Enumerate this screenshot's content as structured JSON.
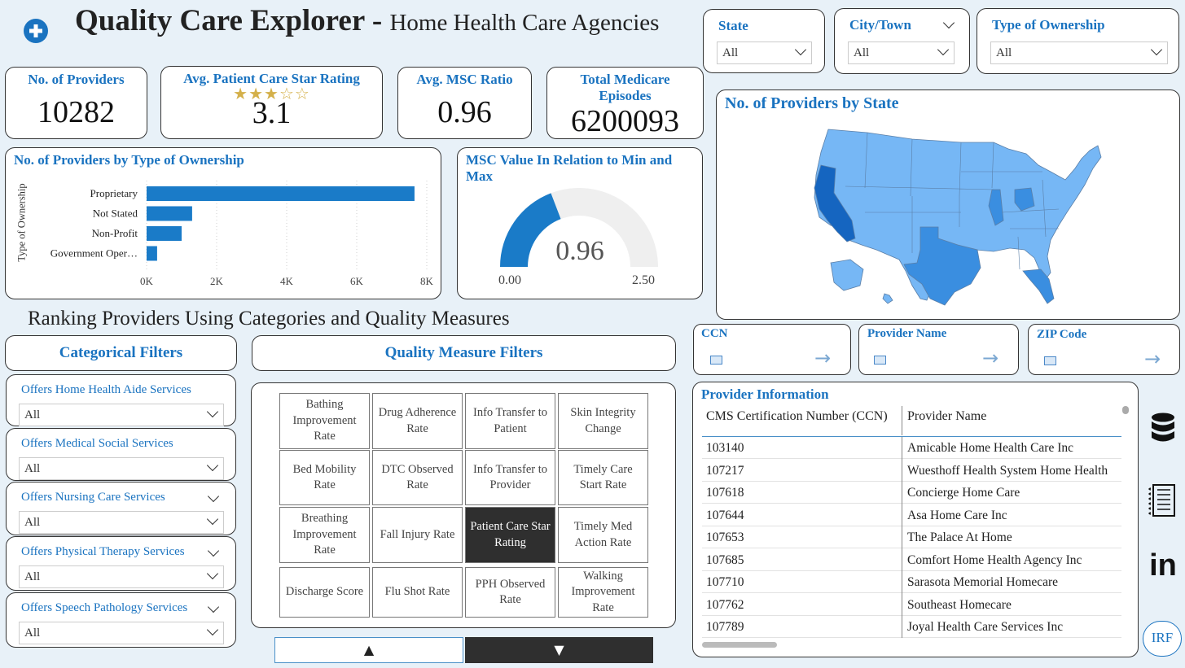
{
  "header": {
    "title_bold": "Quality Care Explorer",
    "title_dash": " - ",
    "title_sub": "Home Health Care Agencies",
    "add_icon": "plus-circle-icon"
  },
  "kpis": {
    "providers": {
      "label": "No. of Providers",
      "value": "10282"
    },
    "star": {
      "label": "Avg. Patient Care Star Rating",
      "stars": "★★★☆☆",
      "rating": 3.1,
      "value": "3.1"
    },
    "msc": {
      "label": "Avg. MSC Ratio",
      "value": "0.96"
    },
    "episodes": {
      "label": "Total Medicare Episodes",
      "value": "6200093"
    }
  },
  "slicers": {
    "state": {
      "label": "State",
      "value": "All"
    },
    "city": {
      "label": "City/Town",
      "value": "All"
    },
    "ownership": {
      "label": "Type of Ownership",
      "value": "All"
    }
  },
  "ownership_chart": {
    "title": "No. of Providers by Type of Ownership",
    "ylabel": "Type of Ownership",
    "ticks": [
      "0K",
      "2K",
      "4K",
      "6K",
      "8K"
    ]
  },
  "gauge": {
    "title_line1": "MSC Value In Relation to Min and",
    "title_line2": "Max",
    "value_label": "0.96",
    "min_label": "0.00",
    "max_label": "2.50",
    "value": 0.96,
    "min": 0,
    "max": 2.5,
    "fill_color": "#1a7bc8",
    "track_color": "#efefef"
  },
  "map": {
    "title": "No. of Providers by State",
    "colors": {
      "base": "#76b7f5",
      "mid": "#3a8ee0",
      "high": "#1565c0",
      "border": "#5a7fa8"
    }
  },
  "ranking": {
    "heading": "Ranking Providers Using Categories and Quality Measures",
    "categorical_title": "Categorical Filters",
    "quality_title": "Quality Measure Filters",
    "categorical": [
      {
        "label": "Offers Home Health Aide Services",
        "value": "All"
      },
      {
        "label": "Offers Medical Social Services",
        "value": "All"
      },
      {
        "label": "Offers Nursing Care Services",
        "value": "All"
      },
      {
        "label": "Offers Physical Therapy Services",
        "value": "All"
      },
      {
        "label": "Offers Speech Pathology Services",
        "value": "All"
      }
    ],
    "quality_grid": [
      [
        "Bathing Improvement Rate",
        "Drug Adherence Rate",
        "Info Transfer to Patient",
        "Skin Integrity Change"
      ],
      [
        "Bed Mobility Rate",
        "DTC Observed Rate",
        "Info Transfer to Provider",
        "Timely Care Start Rate"
      ],
      [
        "Breathing Improvement Rate",
        "Fall Injury Rate",
        "Patient Care Star Rating",
        "Timely Med Action Rate"
      ],
      [
        "Discharge Score",
        "Flu Shot Rate",
        "PPH Observed Rate",
        "Walking Improvement Rate"
      ]
    ],
    "selected": "Patient Care Star Rating",
    "sort_up": "▲",
    "sort_down": "▼"
  },
  "search": {
    "ccn": {
      "label": "CCN"
    },
    "name": {
      "label": "Provider Name"
    },
    "zip": {
      "label": "ZIP Code"
    }
  },
  "provider_table": {
    "title": "Provider Information",
    "columns": [
      "CMS Certification Number (CCN)",
      "Provider Name"
    ],
    "rows": [
      [
        "103140",
        "Amicable Home Health Care Inc"
      ],
      [
        "107217",
        "Wuesthoff Health System Home Health"
      ],
      [
        "107618",
        "Concierge Home Care"
      ],
      [
        "107644",
        "Asa Home Care Inc"
      ],
      [
        "107653",
        "The Palace At Home"
      ],
      [
        "107685",
        "Comfort Home Health Agency Inc"
      ],
      [
        "107710",
        "Sarasota Memorial Homecare"
      ],
      [
        "107762",
        "Southeast Homecare"
      ],
      [
        "107789",
        "Joyal Health Care Services Inc"
      ]
    ]
  },
  "side_icons": {
    "database": "database-icon",
    "notes": "notes-icon",
    "linkedin": "in",
    "irf": "IRF"
  },
  "chart_data": {
    "type": "bar",
    "title": "No. of Providers by Type of Ownership",
    "ylabel": "Type of Ownership",
    "xlabel": "",
    "categories": [
      "Proprietary",
      "Not Stated",
      "Non-Profit",
      "Government Oper…"
    ],
    "values": [
      7650,
      1300,
      1000,
      300
    ],
    "xlim": [
      0,
      8000
    ],
    "orientation": "horizontal",
    "color": "#1a7bc8"
  }
}
